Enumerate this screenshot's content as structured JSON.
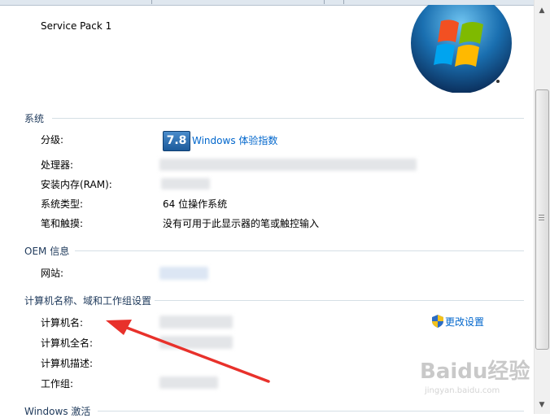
{
  "edition": {
    "service_pack": "Service Pack 1"
  },
  "system": {
    "heading": "系统",
    "rating_label": "分级:",
    "rating_score": "7.8",
    "rating_link": "Windows 体验指数",
    "processor_label": "处理器:",
    "ram_label": "安装内存(RAM):",
    "type_label": "系统类型:",
    "type_value": "64 位操作系统",
    "pen_label": "笔和触摸:",
    "pen_value": "没有可用于此显示器的笔或触控输入"
  },
  "oem": {
    "heading": "OEM 信息",
    "website_label": "网站:"
  },
  "computer": {
    "heading": "计算机名称、域和工作组设置",
    "name_label": "计算机名:",
    "fullname_label": "计算机全名:",
    "desc_label": "计算机描述:",
    "workgroup_label": "工作组:",
    "change_settings": "更改设置"
  },
  "activation": {
    "heading": "Windows 激活"
  },
  "watermark": {
    "brand": "Baidu经验",
    "url": "jingyan.baidu.com"
  },
  "colors": {
    "link": "#0066cc",
    "heading": "#1e395b",
    "arrow": "#e8312b"
  },
  "icons": [
    "windows-logo-icon",
    "uac-shield-icon",
    "scroll-up-arrow-icon",
    "scroll-down-arrow-icon",
    "annotation-arrow-icon"
  ]
}
